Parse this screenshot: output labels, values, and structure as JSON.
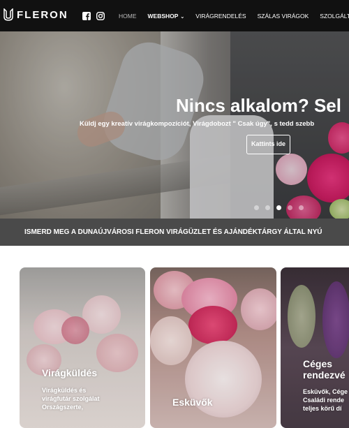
{
  "header": {
    "logo_text": "FLERON",
    "social": [
      "facebook-icon",
      "instagram-icon"
    ],
    "nav": [
      {
        "label": "HOME"
      },
      {
        "label": "WEBSHOP"
      },
      {
        "label": "VIRÁGRENDELÉS"
      },
      {
        "label": "SZÁLAS VIRÁGOK"
      },
      {
        "label": "SZOLGÁLTA"
      }
    ]
  },
  "hero": {
    "title": "Nincs alkalom? Sel",
    "subtitle": "Küldj egy kreatív virágkompozíciót, Virágdobozt \" Csak úgy\", s tedd szebb",
    "button": "Kattints ide",
    "slides": 5,
    "active_slide": 3
  },
  "banner": {
    "text": "ISMERD MEG A DUNAÚJVÁROSI FLERON VIRÁGÜZLET ÉS AJÁNDÉKTÁRGY ÁLTAL NYÚ"
  },
  "cards": [
    {
      "title": "Virágküldés",
      "desc": [
        "Virágküldés és",
        "virágfutár szolgálat",
        "Országszerte,"
      ]
    },
    {
      "title": "Esküvők",
      "desc": []
    },
    {
      "title_lines": [
        "Céges",
        "rendezvé"
      ],
      "desc": [
        "Esküvők, Cége",
        "Családi rende",
        "teljes körű dí"
      ]
    }
  ],
  "colors": {
    "header_bg": "#111111",
    "banner_bg": "#4a4a4a",
    "accent_white": "#ffffff"
  }
}
